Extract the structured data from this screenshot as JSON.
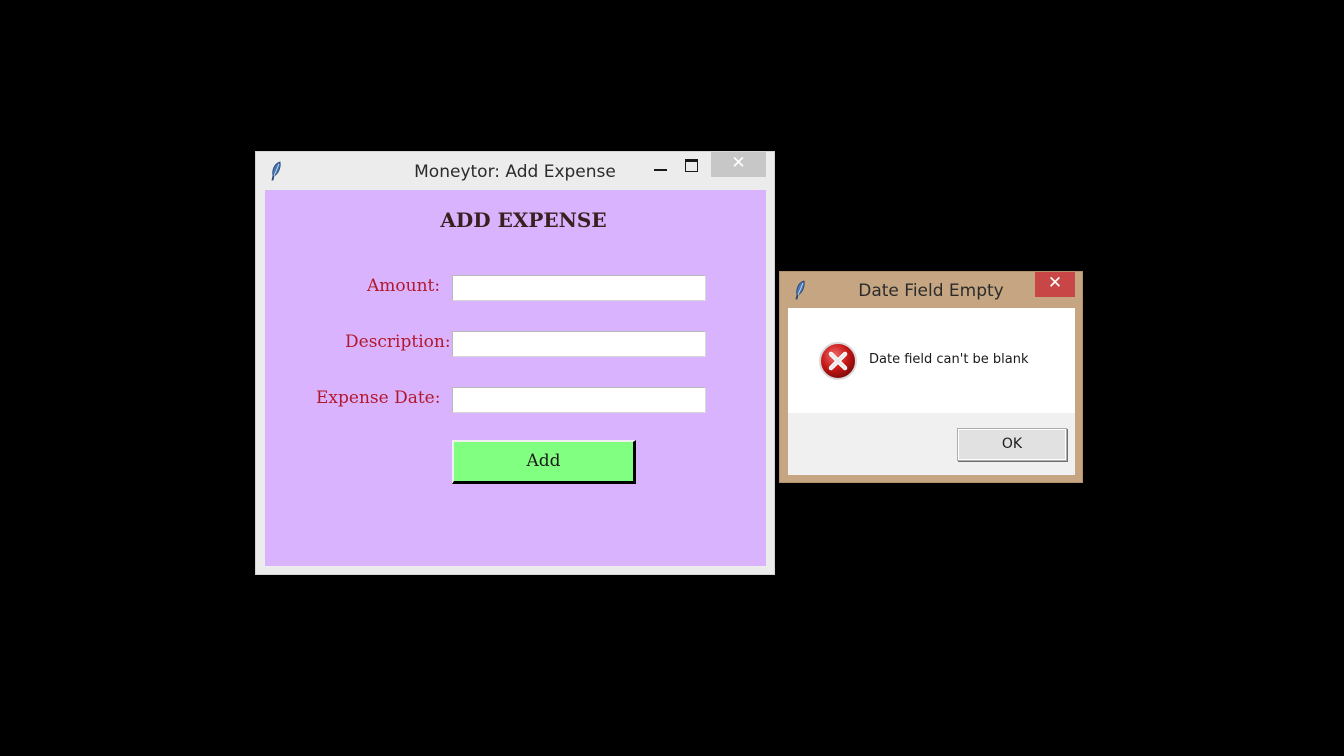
{
  "main_window": {
    "title": "Moneytor: Add Expense",
    "icon": "feather-icon",
    "close_symbol": "✕",
    "heading": "ADD EXPENSE",
    "fields": [
      {
        "label": "Amount:",
        "value": ""
      },
      {
        "label": "Description:",
        "value": ""
      },
      {
        "label": "Expense Date:",
        "value": ""
      }
    ],
    "add_label": "Add",
    "colors": {
      "background": "#dab3ff",
      "label": "#b2182b",
      "button": "#80ff80"
    }
  },
  "dialog": {
    "title": "Date Field Empty",
    "icon": "feather-icon",
    "close_symbol": "✕",
    "error_icon": "error-icon",
    "message": "Date field can't be blank",
    "ok_label": "OK",
    "colors": {
      "frame": "#c5a582",
      "close": "#c94646"
    }
  }
}
